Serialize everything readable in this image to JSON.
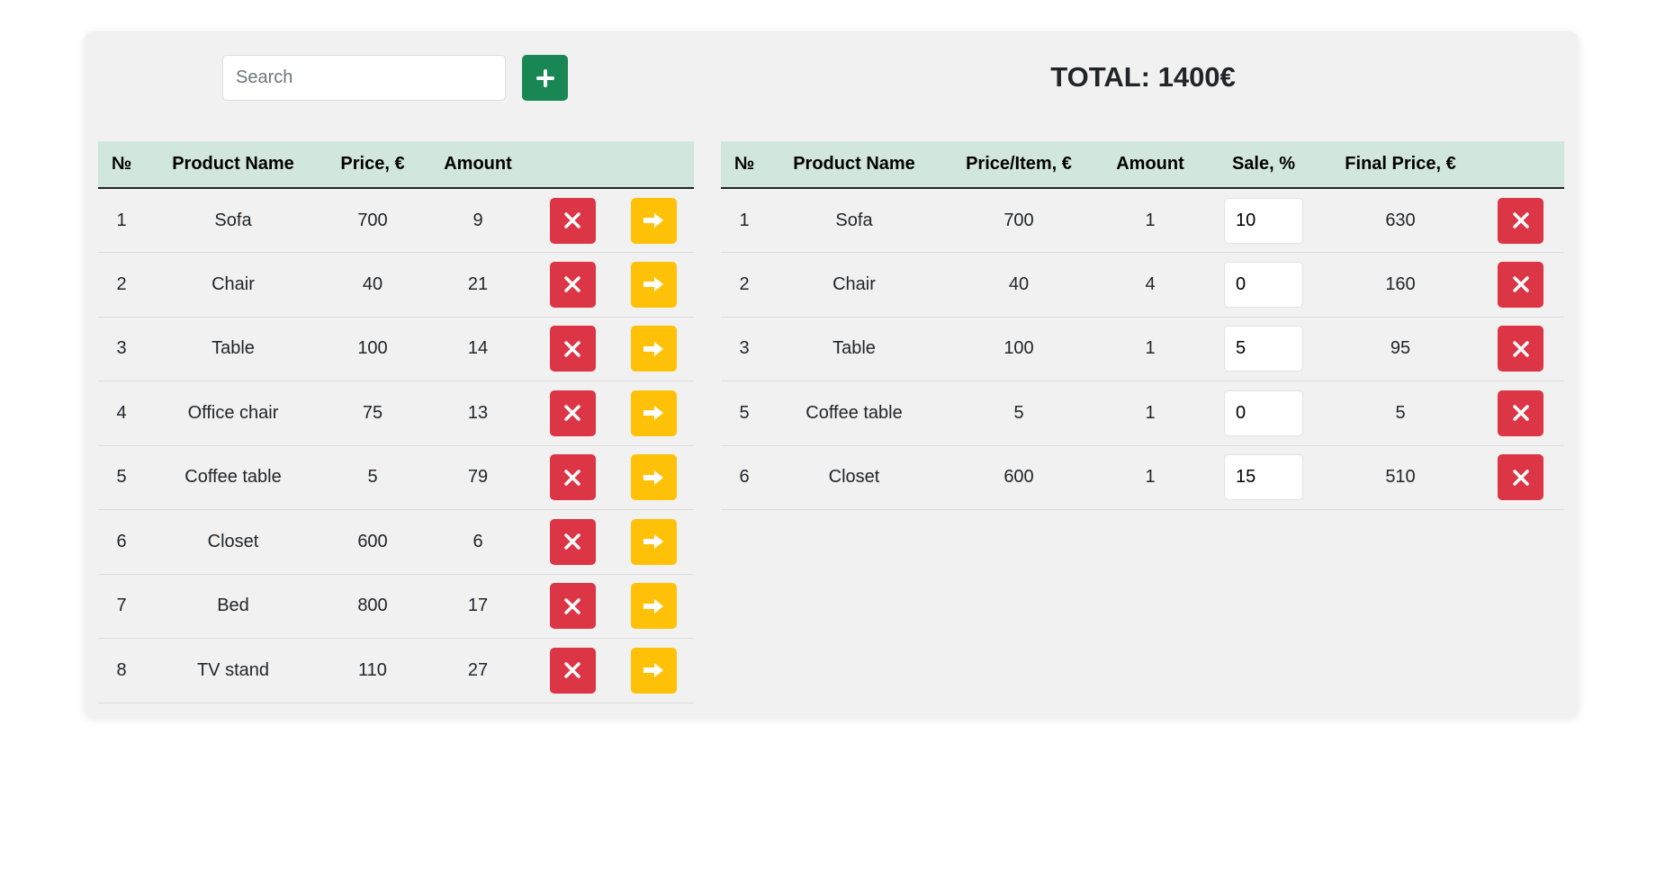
{
  "search": {
    "placeholder": "Search",
    "value": ""
  },
  "add_button": {
    "icon": "plus-icon",
    "color": "#198754"
  },
  "total": {
    "text": "TOTAL: 1400€"
  },
  "left_table": {
    "headers": [
      "№",
      "Product Name",
      "Price, €",
      "Amount",
      "",
      ""
    ],
    "rows": [
      {
        "no": "1",
        "name": "Sofa",
        "price": "700",
        "amount": "9"
      },
      {
        "no": "2",
        "name": "Chair",
        "price": "40",
        "amount": "21"
      },
      {
        "no": "3",
        "name": "Table",
        "price": "100",
        "amount": "14"
      },
      {
        "no": "4",
        "name": "Office chair",
        "price": "75",
        "amount": "13"
      },
      {
        "no": "5",
        "name": "Coffee table",
        "price": "5",
        "amount": "79"
      },
      {
        "no": "6",
        "name": "Closet",
        "price": "600",
        "amount": "6"
      },
      {
        "no": "7",
        "name": "Bed",
        "price": "800",
        "amount": "17"
      },
      {
        "no": "8",
        "name": "TV stand",
        "price": "110",
        "amount": "27"
      }
    ],
    "row_actions": {
      "delete_icon": "close-icon",
      "move_icon": "arrow-right-icon"
    }
  },
  "right_table": {
    "headers": [
      "№",
      "Product Name",
      "Price/Item, €",
      "Amount",
      "Sale, %",
      "Final Price, €",
      ""
    ],
    "rows": [
      {
        "no": "1",
        "name": "Sofa",
        "price": "700",
        "amount": "1",
        "sale": "10",
        "final": "630"
      },
      {
        "no": "2",
        "name": "Chair",
        "price": "40",
        "amount": "4",
        "sale": "0",
        "final": "160"
      },
      {
        "no": "3",
        "name": "Table",
        "price": "100",
        "amount": "1",
        "sale": "5",
        "final": "95"
      },
      {
        "no": "5",
        "name": "Coffee table",
        "price": "5",
        "amount": "1",
        "sale": "0",
        "final": "5"
      },
      {
        "no": "6",
        "name": "Closet",
        "price": "600",
        "amount": "1",
        "sale": "15",
        "final": "510"
      }
    ],
    "row_actions": {
      "delete_icon": "close-icon"
    }
  },
  "colors": {
    "header_bg": "#d1e7dd",
    "danger": "#dc3545",
    "warning": "#ffc107",
    "success": "#198754",
    "panel_bg": "#f1f1f1"
  }
}
